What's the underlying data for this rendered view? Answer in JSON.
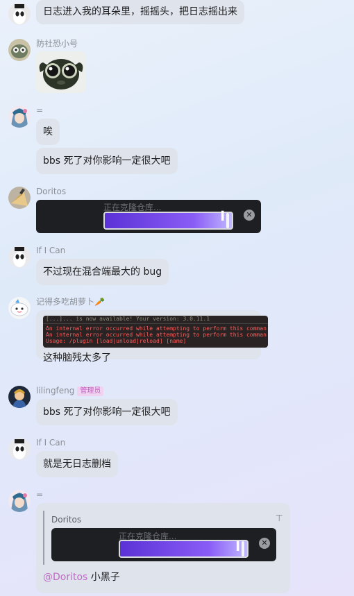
{
  "messages": [
    {
      "text": "日志进入我的耳朵里，摇摇头，把日志摇出来"
    },
    {
      "sender": "防社恐小号"
    },
    {
      "sender": "=",
      "texts": [
        "唉",
        "bbs 死了对你影响一定很大吧"
      ]
    },
    {
      "sender": "Doritos",
      "card_text": "正在克隆仓库..."
    },
    {
      "sender": "If I Can",
      "text": "不过现在混合端最大的 bug"
    },
    {
      "sender": "记得多吃胡萝卜🥕",
      "log_lines": [
        "[...]... is now available! Your version: 3.0.11.1",
        "An internal error occurred while attempting to perform this comman",
        "An internal error occurred while attempting to perform this comman",
        "Usage: /plugin [load|unload|reload] [name]"
      ],
      "text": "这种脑残太多了"
    },
    {
      "sender": "lilingfeng",
      "badge": "管理员",
      "text": "bbs 死了对你影响一定很大吧"
    },
    {
      "sender": "If I Can",
      "text": "就是无日志删档"
    },
    {
      "sender": "=",
      "quote_sender": "Doritos",
      "quote_card_text": "正在克隆仓库...",
      "mention": "@Doritos",
      "text": "小黑子"
    }
  ],
  "icons": {
    "close": "close-icon",
    "pin": "pin-icon",
    "cursor": "cursor-icon"
  },
  "colors": {
    "accent_mention": "#c06ac6",
    "progress": "#7c4ff0"
  }
}
